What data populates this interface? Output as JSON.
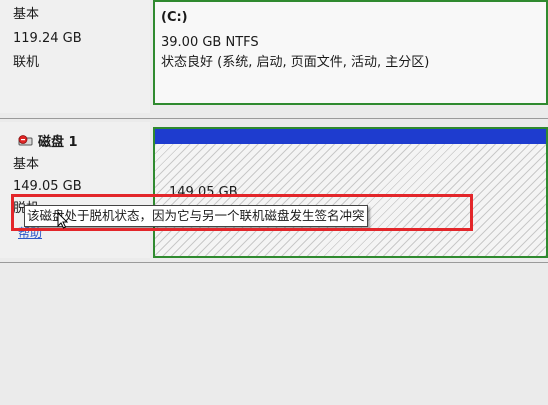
{
  "disk0": {
    "type": "基本",
    "size": "119.24 GB",
    "status": "联机",
    "partition": {
      "name": "(C:)",
      "size_fs": "39.00 GB NTFS",
      "health": "状态良好 (系统, 启动, 页面文件, 活动, 主分区)"
    }
  },
  "disk1": {
    "title": "磁盘 1",
    "type": "基本",
    "size": "149.05 GB",
    "status": "脱机",
    "help_link": "帮助",
    "partition": {
      "size": "149.05 GB"
    }
  },
  "tooltip": {
    "text": "该磁盘处于脱机状态，因为它与另一个联机磁盘发生签名冲突"
  },
  "colors": {
    "partition_border": "#2f8a2f",
    "unallocated_bar": "#1e3ccf",
    "highlight": "#e3262a"
  }
}
